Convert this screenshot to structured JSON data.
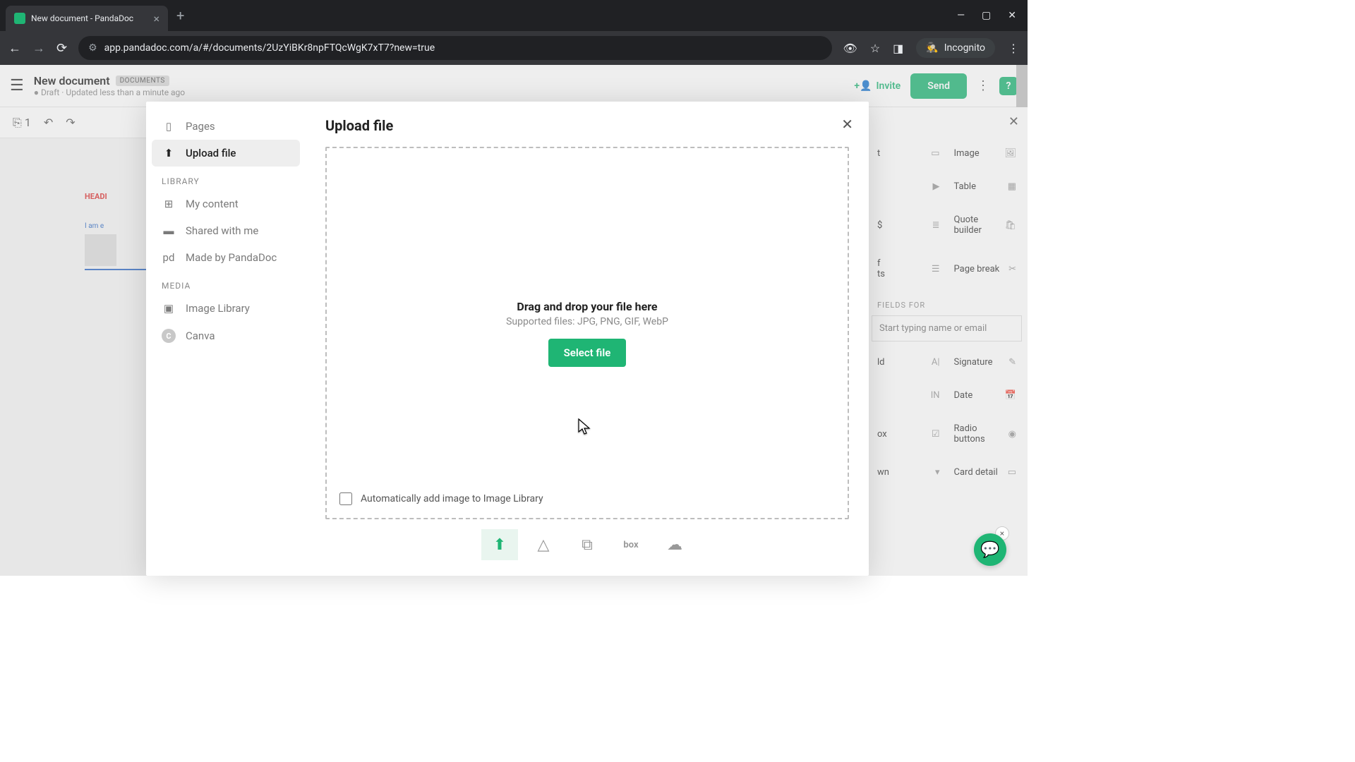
{
  "browser": {
    "tab_title": "New document - PandaDoc",
    "url": "app.pandadoc.com/a/#/documents/2UzYiBKr8npFTQcWgK7xT7?new=true",
    "incognito_label": "Incognito"
  },
  "header": {
    "title": "New document",
    "badge": "DOCUMENTS",
    "status": "Draft",
    "updated": "Updated less than a minute ago",
    "invite": "Invite",
    "send": "Send"
  },
  "toolbar": {
    "page_count": "1"
  },
  "canvas": {
    "heading": "HEADI",
    "body": "I am e"
  },
  "modal": {
    "title": "Upload file",
    "sidebar": {
      "pages": "Pages",
      "upload": "Upload file",
      "library_label": "LIBRARY",
      "my_content": "My content",
      "shared": "Shared with me",
      "made_by": "Made by PandaDoc",
      "media_label": "MEDIA",
      "image_library": "Image Library",
      "canva": "Canva"
    },
    "dropzone": {
      "title": "Drag and drop your file here",
      "subtitle": "Supported files: JPG, PNG, GIF, WebP",
      "button": "Select file",
      "checkbox": "Automatically add image to Image Library"
    },
    "providers": {
      "upload": "upload",
      "gdrive": "gdrive",
      "dropbox": "dropbox",
      "box": "box",
      "onedrive": "onedrive"
    }
  },
  "right_panel": {
    "items": {
      "image": "Image",
      "table": "Table",
      "quote": "Quote builder",
      "pagebreak": "Page break"
    },
    "fields_label": "FIELDS FOR",
    "name_placeholder": "Start typing name or email",
    "fields": {
      "text": "ld",
      "signature": "Signature",
      "initials": "IN",
      "date": "Date",
      "checkbox": "ox",
      "radio": "Radio buttons",
      "dropdown": "wn",
      "card": "Card detail"
    }
  }
}
